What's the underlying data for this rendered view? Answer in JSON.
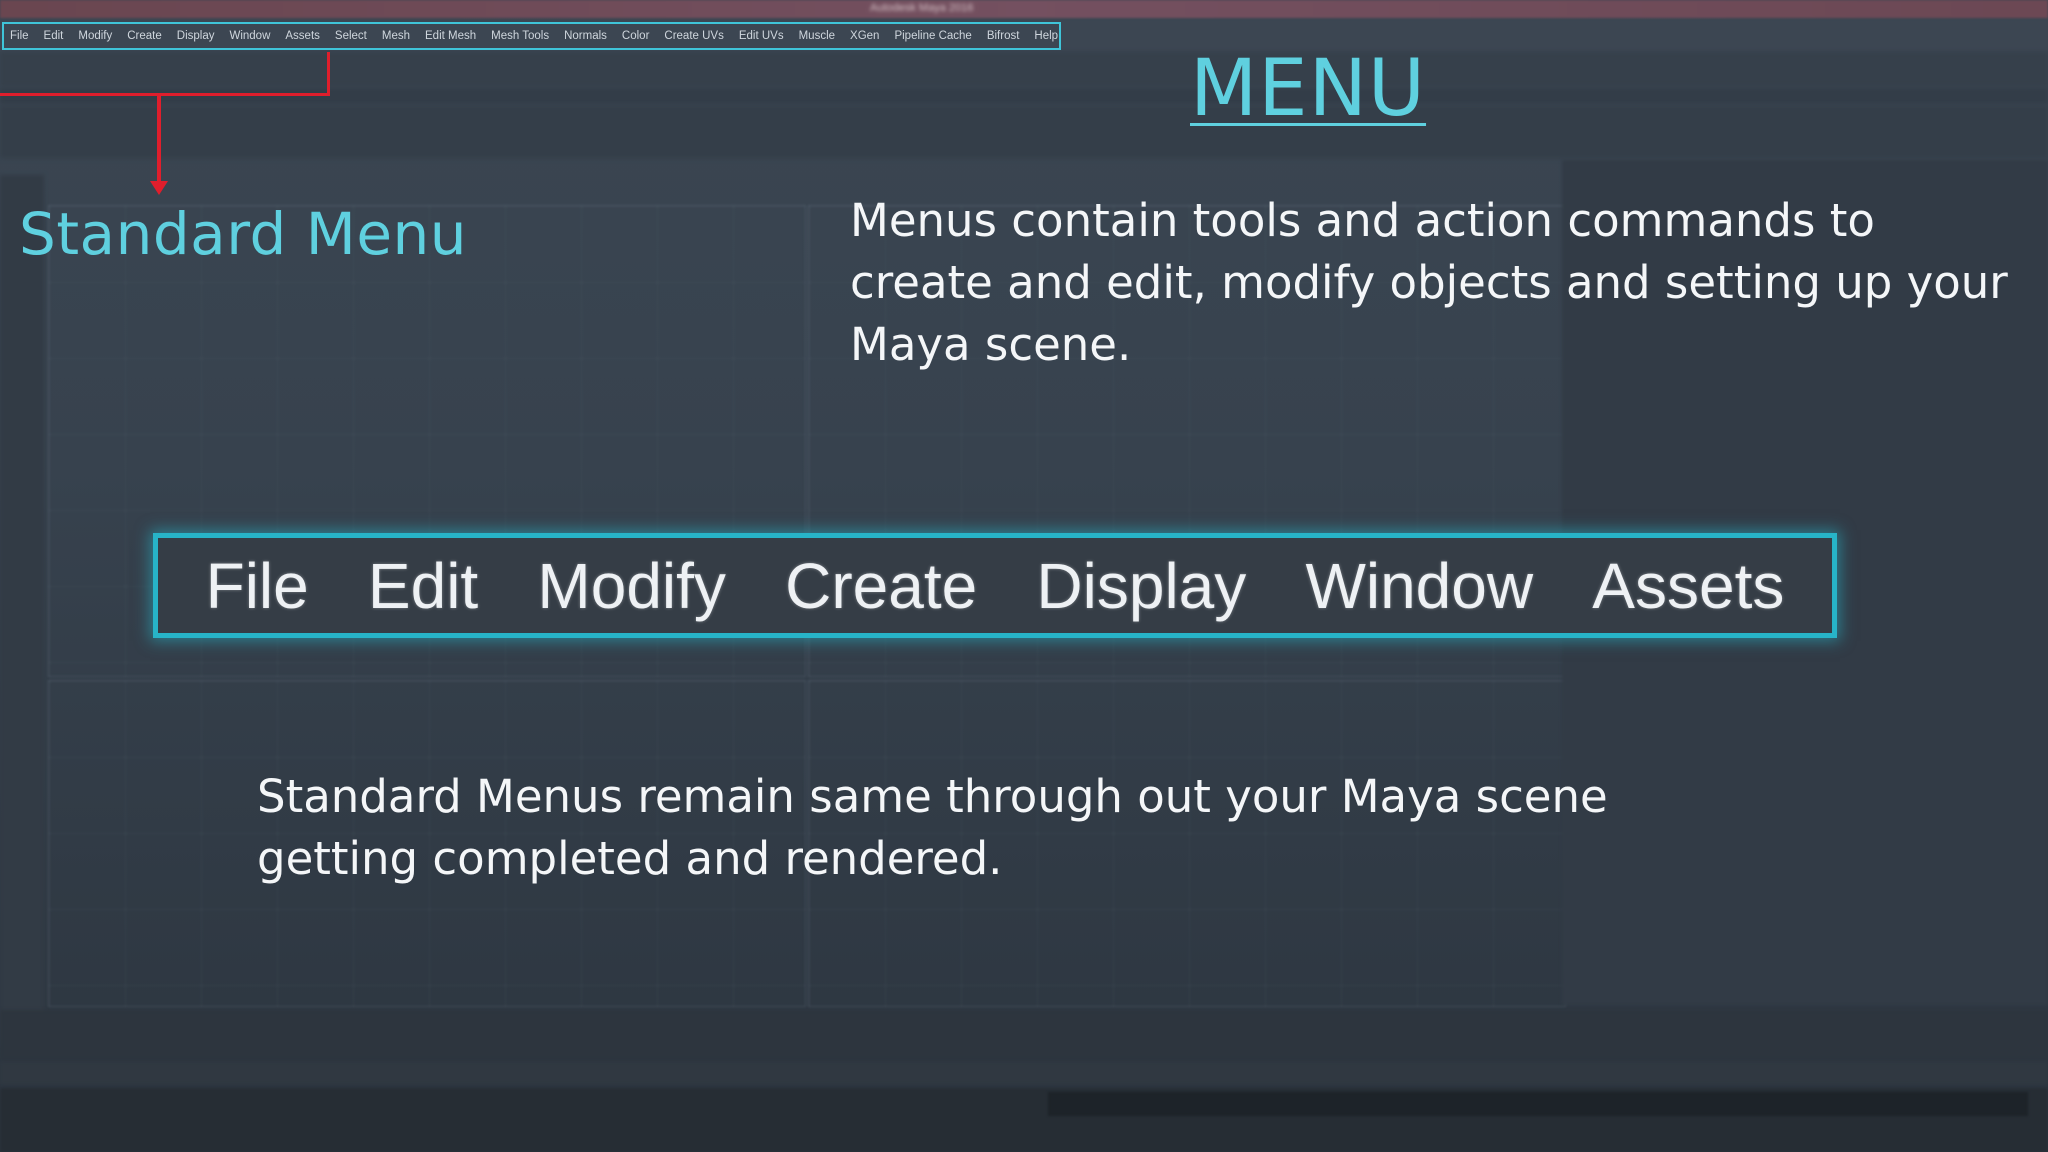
{
  "window": {
    "title": "Autodesk Maya 2016"
  },
  "maya_menu_bar": {
    "items": [
      "File",
      "Edit",
      "Modify",
      "Create",
      "Display",
      "Window",
      "Assets",
      "Select",
      "Mesh",
      "Edit Mesh",
      "Mesh Tools",
      "Normals",
      "Color",
      "Create UVs",
      "Edit UVs",
      "Muscle",
      "XGen",
      "Pipeline Cache",
      "Bifrost",
      "Help"
    ]
  },
  "slide": {
    "title": "MENU",
    "standard_menu_label": "Standard Menu",
    "description_top": "Menus contain tools and action commands to create and edit, modify objects and setting up your Maya scene.",
    "description_bottom": "Standard Menus remain same through out your Maya scene getting completed and rendered.",
    "zoomed_menu": {
      "items": [
        "File",
        "Edit",
        "Modify",
        "Create",
        "Display",
        "Window",
        "Assets"
      ]
    }
  },
  "colors": {
    "accent_cyan": "#5fd0df",
    "highlight_border": "#27b4c8",
    "callout_red": "#e01e2c",
    "background": "#2f3943"
  }
}
